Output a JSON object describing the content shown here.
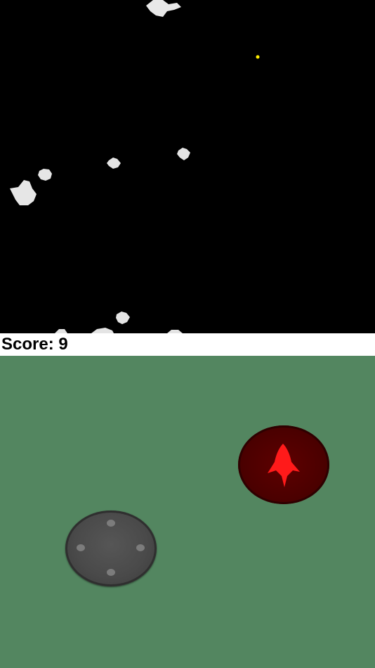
{
  "hud": {
    "score_label": "Score:",
    "score_value": "9"
  },
  "colors": {
    "space": "#000000",
    "asteroid": "#e6e6e6",
    "bullet": "#ffee00",
    "hud_bg": "#ffffff",
    "controls_bg": "#538660",
    "joystick": "#4a4a4a",
    "fire_button": "#4a0000",
    "ship_icon": "#ff1a1a"
  },
  "controls": {
    "joystick_icon": "virtual-joystick",
    "fire_icon": "rocket-ship-icon"
  }
}
